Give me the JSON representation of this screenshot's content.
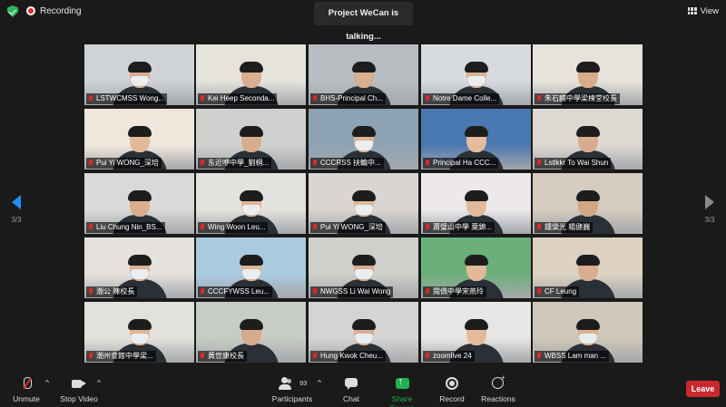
{
  "window": {
    "recording_label": "Recording",
    "talking_label": "Project WeCan is talking...",
    "view_label": "View"
  },
  "pager": {
    "left": "3/3",
    "right": "3/3"
  },
  "tiles": [
    {
      "name": "LSTWCMSS Wong...",
      "bg": "#cfd3d8",
      "skin": "#d8ad8d",
      "mask": true
    },
    {
      "name": "Kei Heep Seconda...",
      "bg": "#e6e3dc",
      "skin": "#d9b08f",
      "mask": false
    },
    {
      "name": "BHS-Principal Ch...",
      "bg": "#b8bdc2",
      "skin": "#d9ae8c",
      "mask": false
    },
    {
      "name": "Notre Dame Colle...",
      "bg": "#d7dbdf",
      "skin": "#dcb392",
      "mask": true
    },
    {
      "name": "朱石麟中學梁楝堂校長",
      "bg": "#e7e3dc",
      "skin": "#d8ab8a",
      "mask": false
    },
    {
      "name": "Pui Yi WONG_深培",
      "bg": "#efe7dc",
      "skin": "#e3ba99",
      "mask": false
    },
    {
      "name": "东近咿中學_劉桐...",
      "bg": "#cfd1cf",
      "skin": "#d7ad8c",
      "mask": false
    },
    {
      "name": "CCCRSS 扶輪中...",
      "bg": "#8da3b4",
      "skin": "#dcb293",
      "mask": true
    },
    {
      "name": "Principal Ha CCC...",
      "bg": "#4a78b0",
      "skin": "#e4bd9d",
      "mask": false
    },
    {
      "name": "Lstlkkr To Wai Shun",
      "bg": "#ddd8d2",
      "skin": "#d7ad8d",
      "mask": false
    },
    {
      "name": "Liu Chung Nin_BS...",
      "bg": "#d9dad8",
      "skin": "#d9af8f",
      "mask": false
    },
    {
      "name": "Wing Woon Leu...",
      "bg": "#e4e2df",
      "skin": "#e0b797",
      "mask": true
    },
    {
      "name": "Pui Yi WONG_深培",
      "bg": "#d9d5d2",
      "skin": "#e1b998",
      "mask": true
    },
    {
      "name": "蕭璧山中學 葉錦...",
      "bg": "#ece8ec",
      "skin": "#e2ba9a",
      "mask": false
    },
    {
      "name": "鍾榮光 楊健巍",
      "bg": "#d5cbbf",
      "skin": "#d2a685",
      "mask": false
    },
    {
      "name": "潮公 陳校長",
      "bg": "#e5e2dd",
      "skin": "#dcb394",
      "mask": true
    },
    {
      "name": "CCCFYWSS Leu...",
      "bg": "#a9cbe0",
      "skin": "#deb595",
      "mask": true
    },
    {
      "name": "NWGSS Li Wai Wong",
      "bg": "#cfd0cb",
      "skin": "#d7ad8e",
      "mask": true
    },
    {
      "name": "閩僑中學宋燕玲",
      "bg": "#6bb07a",
      "skin": "#e1b999",
      "mask": false
    },
    {
      "name": "CF Leung",
      "bg": "#ddd2c2",
      "skin": "#d8ae8e",
      "mask": false
    },
    {
      "name": "潮州會館中學梁...",
      "bg": "#e3e1dc",
      "skin": "#dfb696",
      "mask": true
    },
    {
      "name": "黃世康校長",
      "bg": "#c8ccc6",
      "skin": "#d6ab8b",
      "mask": false
    },
    {
      "name": "Hung Kwok Cheu...",
      "bg": "#d5d4d2",
      "skin": "#d8ae8e",
      "mask": true
    },
    {
      "name": "zoomlive 24",
      "bg": "#e8e6e4",
      "skin": "#e3bb9b",
      "mask": false
    },
    {
      "name": "WBSS Lam man ...",
      "bg": "#cfc7b9",
      "skin": "#dbb191",
      "mask": true
    }
  ],
  "controls": {
    "unmute": "Unmute",
    "stop_video": "Stop Video",
    "participants": "Participants",
    "participants_count": "93",
    "chat": "Chat",
    "share_screen": "Share Screen",
    "record": "Record",
    "reactions": "Reactions",
    "leave": "Leave"
  },
  "colors": {
    "accent_blue": "#1e90ff",
    "share_green": "#23b14d",
    "leave_red": "#c9282d",
    "muted_red": "#e02828"
  }
}
